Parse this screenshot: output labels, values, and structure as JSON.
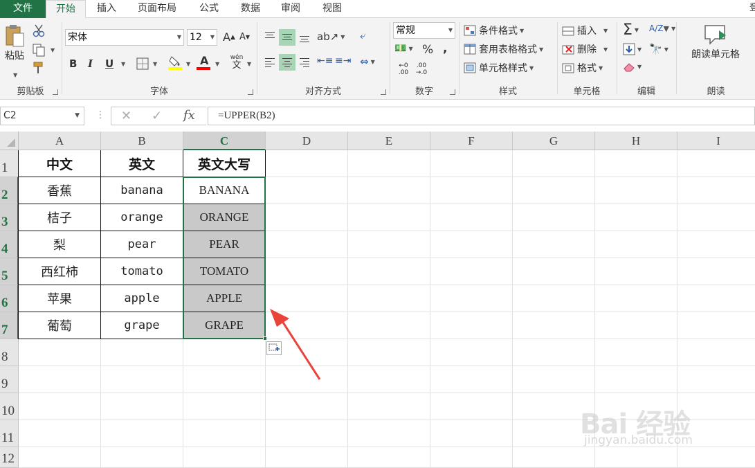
{
  "tabs": {
    "file": "文件",
    "home": "开始",
    "insert": "插入",
    "page_layout": "页面布局",
    "formulas": "公式",
    "data": "数据",
    "review": "审阅",
    "view": "视图",
    "cut_off": "登"
  },
  "ribbon": {
    "clipboard": {
      "label": "剪贴板",
      "paste": "粘贴"
    },
    "font": {
      "label": "字体",
      "font_name": "宋体",
      "font_size": "12",
      "bold": "B",
      "italic": "I",
      "underline": "U",
      "grow": "A",
      "shrink": "A",
      "phonetic_top": "wén",
      "phonetic_bottom": "文",
      "fill_color": "#ffff00",
      "font_color": "#ff0000"
    },
    "alignment": {
      "label": "对齐方式"
    },
    "number": {
      "label": "数字",
      "format": "常规",
      "percent": "%",
      "comma": ",",
      "inc_decimal_top": "←0",
      "inc_decimal_bottom": ".00",
      "dec_decimal_top": ".00",
      "dec_decimal_bottom": "→.0"
    },
    "styles": {
      "label": "样式",
      "conditional": "条件格式",
      "table_format": "套用表格格式",
      "cell_styles": "单元格样式"
    },
    "cells": {
      "label": "单元格",
      "insert": "插入",
      "delete": "删除",
      "format": "格式"
    },
    "editing": {
      "label": "编辑",
      "sum": "Σ",
      "sort": "A/Z"
    },
    "read": {
      "label": "朗读",
      "read_cells": "朗读单元格"
    }
  },
  "formula_bar": {
    "name_box": "C2",
    "dots": "⋮",
    "cancel": "✕",
    "enter": "✓",
    "fx": "fx",
    "formula": "=UPPER(B2)"
  },
  "sheet": {
    "columns": [
      "A",
      "B",
      "C",
      "D",
      "E",
      "F",
      "G",
      "H",
      "I"
    ],
    "rows": [
      "1",
      "2",
      "3",
      "4",
      "5",
      "6",
      "7",
      "8",
      "9",
      "10",
      "11",
      "12"
    ],
    "headers": [
      "中文",
      "英文",
      "英文大写"
    ],
    "data": [
      [
        "香蕉",
        "banana",
        "BANANA"
      ],
      [
        "桔子",
        "orange",
        "ORANGE"
      ],
      [
        "梨",
        "pear",
        "PEAR"
      ],
      [
        "西红柿",
        "tomato",
        "TOMATO"
      ],
      [
        "苹果",
        "apple",
        "APPLE"
      ],
      [
        "葡萄",
        "grape",
        "GRAPE"
      ]
    ],
    "selected_column": "C",
    "accent_color": "#217346",
    "arrow_color": "#e8443a"
  },
  "watermark": {
    "brand": "Bai 经验",
    "url": "jingyan.baidu.com"
  }
}
